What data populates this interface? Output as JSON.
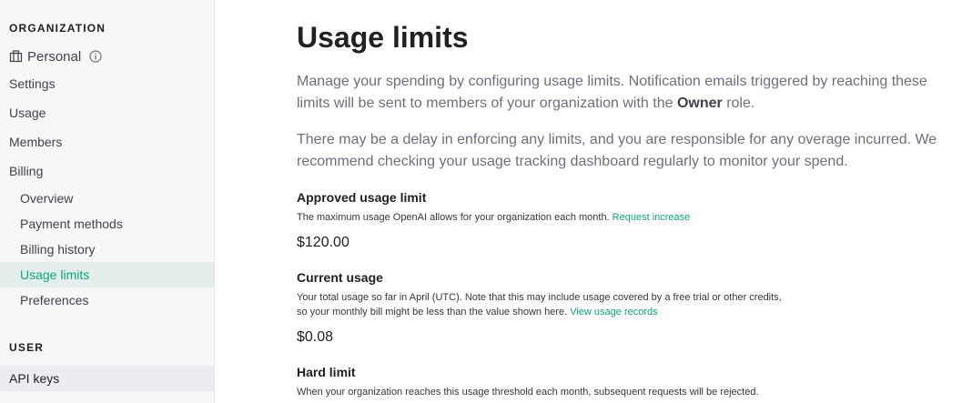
{
  "sidebar": {
    "org_heading": "ORGANIZATION",
    "org_name": "Personal",
    "items": {
      "settings": "Settings",
      "usage": "Usage",
      "members": "Members",
      "billing": "Billing",
      "overview": "Overview",
      "payment_methods": "Payment methods",
      "billing_history": "Billing history",
      "usage_limits": "Usage limits",
      "preferences": "Preferences"
    },
    "user_heading": "USER",
    "api_keys": "API keys",
    "accent_color": "#10a37f"
  },
  "main": {
    "title": "Usage limits",
    "intro": {
      "part1": "Manage your spending by configuring usage limits. Notification emails triggered by reaching these limits will be sent to members of your organization with the ",
      "bold": "Owner",
      "part2": " role."
    },
    "delay_note": "There may be a delay in enforcing any limits, and you are responsible for any overage incurred. We recommend checking your usage tracking dashboard regularly to monitor your spend.",
    "approved": {
      "label": "Approved usage limit",
      "desc": "The maximum usage OpenAI allows for your organization each month. ",
      "link": "Request increase",
      "value": "$120.00"
    },
    "current": {
      "label": "Current usage",
      "desc_line1": "Your total usage so far in April (UTC). Note that this may include usage covered by a free trial or other credits,",
      "desc_line2": "so your monthly bill might be less than the value shown here. ",
      "link": "View usage records",
      "value": "$0.08"
    },
    "hard_limit": {
      "label": "Hard limit",
      "desc": "When your organization reaches this usage threshold each month, subsequent requests will be rejected."
    }
  }
}
